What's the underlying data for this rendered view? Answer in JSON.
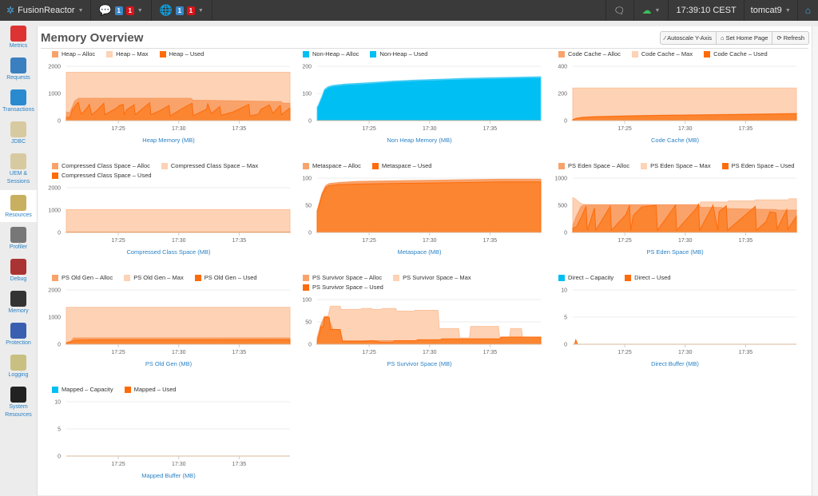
{
  "topbar": {
    "app_name": "FusionReactor",
    "notifications": {
      "icon": "alert-bubble-icon",
      "count_blue": "1",
      "count_red": "1"
    },
    "globe": {
      "icon": "globe-icon",
      "count_blue": "1",
      "count_red": "1"
    },
    "chat_icon": "chat-icon",
    "status_icon": "cloud-up-icon",
    "clock": "17:39:10 CEST",
    "instance": "tomcat9",
    "home_icon": "home-icon"
  },
  "sidebar": {
    "items": [
      {
        "label": "Metrics",
        "icon": "metrics-icon",
        "color": "#d33",
        "active": false
      },
      {
        "label": "Requests",
        "icon": "requests-icon",
        "color": "#3a7fc0",
        "active": false
      },
      {
        "label": "Transactions",
        "icon": "transactions-icon",
        "color": "#2a8ad0",
        "active": false
      },
      {
        "label": "JDBC",
        "icon": "jdbc-icon",
        "color": "#d8caa0",
        "active": false
      },
      {
        "label": "UEM &",
        "label2": "Sessions",
        "icon": "uem-sessions-icon",
        "color": "#d8caa0",
        "active": false
      },
      {
        "label": "Resources",
        "icon": "resources-icon",
        "color": "#c8b060",
        "active": true
      },
      {
        "label": "Profiler",
        "icon": "profiler-icon",
        "color": "#777",
        "active": false
      },
      {
        "label": "Debug",
        "icon": "debug-icon",
        "color": "#a33",
        "active": false
      },
      {
        "label": "Memory",
        "icon": "memory-icon",
        "color": "#333",
        "active": false
      },
      {
        "label": "Protection",
        "icon": "protection-icon",
        "color": "#3a5fb0",
        "active": false
      },
      {
        "label": "Logging",
        "icon": "logging-icon",
        "color": "#c8c080",
        "active": false
      },
      {
        "label": "System",
        "label2": "Resources",
        "icon": "system-resources-icon",
        "color": "#222",
        "active": false
      }
    ]
  },
  "page": {
    "title": "Memory Overview",
    "buttons": [
      {
        "label": "Autoscale Y-Axis",
        "icon": "wand-icon"
      },
      {
        "label": "Set Home Page",
        "icon": "home-icon"
      },
      {
        "label": "Refresh",
        "icon": "refresh-icon"
      }
    ]
  },
  "colors": {
    "alloc": "#f9a36b",
    "max": "#fdd2b5",
    "used": "#ff6b0a",
    "used_fill": "#fb8530",
    "blue": "#00bff3",
    "grid": "#eeeeee"
  },
  "chart_data": [
    {
      "type": "area",
      "title": "Heap Memory (MB)",
      "ylim": [
        0,
        2000
      ],
      "yticks": [
        0,
        1000,
        2000
      ],
      "xticks": [
        "17:25",
        "17:30",
        "17:35"
      ],
      "xrange_min": [
        20.7,
        39.2
      ],
      "series": [
        {
          "name": "Heap - Max",
          "kind": "max",
          "x": [
            20.7,
            39.2
          ],
          "values": [
            1780,
            1780
          ]
        },
        {
          "name": "Heap - Alloc",
          "kind": "alloc",
          "x": [
            20.7,
            21.0,
            21.4,
            21.7,
            31.0,
            31.2,
            38.5,
            38.6,
            39.2
          ],
          "values": [
            300,
            300,
            720,
            820,
            820,
            750,
            700,
            640,
            640
          ]
        },
        {
          "name": "Heap - Used",
          "kind": "used",
          "x": [
            20.7,
            21.0,
            21.2,
            21.6,
            21.7,
            21.9,
            22.1,
            22.5,
            22.6,
            22.8,
            23.2,
            23.8,
            23.9,
            24.8,
            25.1,
            25.4,
            25.5,
            25.7,
            26.3,
            26.4,
            27.6,
            27.7,
            28.5,
            29.2,
            29.3,
            30.5,
            31.1,
            31.2,
            32.3,
            32.4,
            32.7,
            33.4,
            33.5,
            34.5,
            35.8,
            35.9,
            36.6,
            36.8,
            37.5,
            37.8,
            38.0,
            38.4,
            38.5,
            39.2
          ],
          "values": [
            120,
            120,
            400,
            640,
            670,
            260,
            300,
            520,
            600,
            220,
            360,
            640,
            220,
            450,
            560,
            600,
            220,
            400,
            580,
            220,
            660,
            220,
            380,
            560,
            180,
            500,
            640,
            180,
            420,
            620,
            260,
            520,
            200,
            320,
            600,
            170,
            240,
            420,
            580,
            260,
            380,
            560,
            220,
            470
          ]
        }
      ]
    },
    {
      "type": "area",
      "title": "Non Heap Memory (MB)",
      "ylim": [
        0,
        200
      ],
      "yticks": [
        0,
        100,
        200
      ],
      "xticks": [
        "17:25",
        "17:30",
        "17:35"
      ],
      "xrange_min": [
        20.7,
        39.2
      ],
      "series": [
        {
          "name": "Non-Heap - Alloc",
          "kind": "blue",
          "x": [
            20.7,
            20.8,
            21.1,
            21.3,
            21.6,
            22.0,
            23.0,
            25.0,
            27.0,
            29.0,
            31.0,
            33.0,
            35.0,
            37.0,
            39.2
          ],
          "values": [
            50,
            58,
            90,
            115,
            125,
            130,
            135,
            140,
            146,
            150,
            153,
            156,
            158,
            160,
            162
          ]
        },
        {
          "name": "Non-Heap - Used",
          "kind": "blue",
          "x": [
            20.7,
            20.8,
            21.1,
            21.3,
            21.6,
            22.0,
            23.0,
            25.0,
            27.0,
            29.0,
            31.0,
            33.0,
            35.0,
            37.0,
            39.2
          ],
          "values": [
            48,
            56,
            88,
            112,
            122,
            127,
            132,
            137,
            143,
            147,
            150,
            153,
            155,
            157,
            159
          ]
        }
      ]
    },
    {
      "type": "area",
      "title": "Code Cache (MB)",
      "ylim": [
        0,
        400
      ],
      "yticks": [
        0,
        200,
        400
      ],
      "xticks": [
        "17:25",
        "17:30",
        "17:35"
      ],
      "xrange_min": [
        20.7,
        39.2
      ],
      "series": [
        {
          "name": "Code Cache - Max",
          "kind": "max",
          "x": [
            20.7,
            39.2
          ],
          "values": [
            240,
            240
          ]
        },
        {
          "name": "Code Cache - Alloc",
          "kind": "alloc",
          "x": [
            20.7,
            21.0,
            21.5,
            22.5,
            25.0,
            28.0,
            31.0,
            34.0,
            37.0,
            39.2
          ],
          "values": [
            8,
            18,
            25,
            30,
            35,
            40,
            43,
            46,
            50,
            53
          ]
        },
        {
          "name": "Code Cache - Used",
          "kind": "used",
          "x": [
            20.7,
            21.0,
            21.5,
            22.5,
            25.0,
            28.0,
            31.0,
            34.0,
            37.0,
            39.2
          ],
          "values": [
            6,
            16,
            23,
            28,
            33,
            38,
            41,
            44,
            48,
            51
          ]
        }
      ]
    },
    {
      "type": "area",
      "title": "Compressed Class Space (MB)",
      "ylim": [
        0,
        2000
      ],
      "yticks": [
        0,
        1000,
        2000
      ],
      "xticks": [
        "17:25",
        "17:30",
        "17:35"
      ],
      "xrange_min": [
        20.7,
        39.2
      ],
      "series": [
        {
          "name": "Compressed Class Space - Max",
          "kind": "max",
          "x": [
            20.7,
            39.2
          ],
          "values": [
            1024,
            1024
          ]
        },
        {
          "name": "Compressed Class Space - Alloc",
          "kind": "alloc",
          "x": [
            20.7,
            39.2
          ],
          "values": [
            12,
            12
          ]
        },
        {
          "name": "Compressed Class Space - Used",
          "kind": "used",
          "x": [
            20.7,
            39.2
          ],
          "values": [
            11,
            11
          ]
        }
      ]
    },
    {
      "type": "area",
      "title": "Metaspace (MB)",
      "ylim": [
        0,
        100
      ],
      "yticks": [
        0,
        50,
        100
      ],
      "xticks": [
        "17:25",
        "17:30",
        "17:35"
      ],
      "xrange_min": [
        20.7,
        39.2
      ],
      "series": [
        {
          "name": "Metaspace - Alloc",
          "kind": "alloc",
          "x": [
            20.7,
            20.8,
            21.1,
            21.4,
            21.7,
            22.5,
            24.0,
            27.0,
            30.0,
            33.0,
            36.0,
            39.2
          ],
          "values": [
            40,
            48,
            72,
            86,
            90,
            92,
            94,
            95,
            96,
            97,
            98,
            98
          ]
        },
        {
          "name": "Metaspace - Used",
          "kind": "used",
          "x": [
            20.7,
            20.8,
            21.1,
            21.4,
            21.7,
            22.5,
            24.0,
            27.0,
            30.0,
            33.0,
            36.0,
            39.2
          ],
          "values": [
            38,
            45,
            68,
            82,
            86,
            88,
            89,
            90,
            91,
            92,
            93,
            93
          ]
        }
      ]
    },
    {
      "type": "area",
      "title": "PS Eden Space (MB)",
      "ylim": [
        0,
        1000
      ],
      "yticks": [
        0,
        500,
        1000
      ],
      "xticks": [
        "17:25",
        "17:30",
        "17:35"
      ],
      "xrange_min": [
        20.7,
        39.2
      ],
      "series": [
        {
          "name": "PS Eden Space - Max",
          "kind": "max",
          "x": [
            20.7,
            20.9,
            21.3,
            21.7,
            31.2,
            31.3,
            33.5,
            33.6,
            35.7,
            35.8,
            38.5,
            38.6,
            39.2
          ],
          "values": [
            640,
            620,
            540,
            510,
            510,
            560,
            560,
            580,
            580,
            600,
            600,
            620,
            620
          ]
        },
        {
          "name": "PS Eden Space - Alloc",
          "kind": "alloc",
          "x": [
            20.7,
            21.0,
            21.4,
            21.7,
            31.1,
            31.3,
            33.0,
            33.2,
            37.5,
            37.7,
            39.2
          ],
          "values": [
            120,
            300,
            480,
            510,
            510,
            460,
            460,
            440,
            420,
            410,
            410
          ]
        },
        {
          "name": "PS Eden Space - Used",
          "kind": "used",
          "x": [
            20.7,
            21.0,
            21.4,
            21.8,
            21.9,
            22.5,
            22.6,
            23.8,
            23.9,
            25.1,
            25.4,
            25.5,
            25.7,
            26.4,
            27.6,
            27.7,
            29.2,
            29.3,
            30.9,
            31.1,
            31.2,
            32.3,
            32.7,
            32.8,
            33.4,
            33.5,
            35.8,
            35.9,
            36.7,
            37.0,
            37.5,
            37.6,
            38.4,
            38.5,
            39.2
          ],
          "values": [
            80,
            100,
            280,
            480,
            40,
            450,
            40,
            480,
            40,
            330,
            500,
            40,
            310,
            470,
            500,
            40,
            500,
            40,
            440,
            520,
            40,
            500,
            40,
            380,
            490,
            40,
            480,
            40,
            200,
            380,
            360,
            60,
            420,
            60,
            300
          ]
        }
      ]
    },
    {
      "type": "area",
      "title": "PS Old Gen (MB)",
      "ylim": [
        0,
        2000
      ],
      "yticks": [
        0,
        1000,
        2000
      ],
      "xticks": [
        "17:25",
        "17:30",
        "17:35"
      ],
      "xrange_min": [
        20.7,
        39.2
      ],
      "series": [
        {
          "name": "PS Old Gen - Max",
          "kind": "max",
          "x": [
            20.7,
            39.2
          ],
          "values": [
            1360,
            1360
          ]
        },
        {
          "name": "PS Old Gen - Alloc",
          "kind": "alloc",
          "x": [
            20.7,
            21.1,
            21.3,
            39.2
          ],
          "values": [
            60,
            120,
            230,
            230
          ]
        },
        {
          "name": "PS Old Gen - Used",
          "kind": "used",
          "x": [
            20.7,
            21.1,
            21.4,
            23.0,
            39.2
          ],
          "values": [
            40,
            90,
            150,
            160,
            165
          ]
        }
      ]
    },
    {
      "type": "area",
      "title": "PS Survivor Space (MB)",
      "ylim": [
        0,
        100
      ],
      "yticks": [
        0,
        50,
        100
      ],
      "xticks": [
        "17:25",
        "17:30",
        "17:35"
      ],
      "xrange_min": [
        20.7,
        39.2
      ],
      "series": [
        {
          "name": "PS Survivor Space - Max",
          "kind": "max",
          "x": [
            20.7,
            21.0,
            21.3,
            21.6,
            21.8,
            22.0,
            22.6,
            22.7,
            24.3,
            24.4,
            25.2,
            25.3,
            26.0,
            26.1,
            27.2,
            27.3,
            28.7,
            28.8,
            30.7,
            30.8,
            32.4,
            32.5,
            33.3,
            33.4,
            34.3,
            34.4,
            35.7,
            35.8,
            36.6,
            36.7,
            37.6,
            37.7,
            39.2
          ],
          "values": [
            15,
            45,
            62,
            62,
            85,
            85,
            85,
            78,
            78,
            80,
            80,
            78,
            78,
            80,
            80,
            74,
            74,
            76,
            76,
            35,
            35,
            14,
            14,
            40,
            40,
            40,
            40,
            14,
            14,
            35,
            35,
            15,
            15
          ]
        },
        {
          "name": "PS Survivor Space - Alloc",
          "kind": "alloc",
          "x": [
            20.7,
            21.0,
            21.3,
            21.6,
            22.0,
            22.6,
            22.8,
            39.2
          ],
          "values": [
            12,
            40,
            62,
            62,
            33,
            33,
            8,
            8
          ]
        },
        {
          "name": "PS Survivor Space - Used",
          "kind": "used",
          "x": [
            20.7,
            20.9,
            21.0,
            21.2,
            21.3,
            21.7,
            21.8,
            22.6,
            22.8,
            24.5,
            25.2,
            25.3,
            26.0,
            26.1,
            27.0,
            27.1,
            28.9,
            29.0,
            30.9,
            31.0,
            35.8,
            35.9,
            39.2
          ],
          "values": [
            2,
            25,
            40,
            38,
            60,
            60,
            33,
            33,
            6,
            6,
            8,
            8,
            4,
            4,
            4,
            8,
            8,
            10,
            10,
            12,
            12,
            16,
            16
          ]
        }
      ]
    },
    {
      "type": "area",
      "title": "Direct Buffer (MB)",
      "ylim": [
        0,
        10
      ],
      "yticks": [
        0,
        5,
        10
      ],
      "xticks": [
        "17:25",
        "17:30",
        "17:35"
      ],
      "xrange_min": [
        20.7,
        39.2
      ],
      "series": [
        {
          "name": "Direct - Capacity",
          "kind": "blue_line",
          "x": [
            20.7,
            39.2
          ],
          "values": [
            0,
            0
          ]
        },
        {
          "name": "Direct - Used",
          "kind": "used",
          "x": [
            20.7,
            20.85,
            20.95,
            21.1,
            39.2
          ],
          "values": [
            0,
            0,
            0.8,
            0,
            0
          ]
        }
      ]
    },
    {
      "type": "area",
      "title": "Mapped Buffer (MB)",
      "ylim": [
        0,
        10
      ],
      "yticks": [
        0,
        5,
        10
      ],
      "xticks": [
        "17:25",
        "17:30",
        "17:35"
      ],
      "xrange_min": [
        20.7,
        39.2
      ],
      "series": [
        {
          "name": "Mapped - Capacity",
          "kind": "blue_line",
          "x": [
            20.7,
            39.2
          ],
          "values": [
            0,
            0
          ]
        },
        {
          "name": "Mapped - Used",
          "kind": "used",
          "x": [
            20.7,
            39.2
          ],
          "values": [
            0,
            0
          ]
        }
      ]
    }
  ]
}
